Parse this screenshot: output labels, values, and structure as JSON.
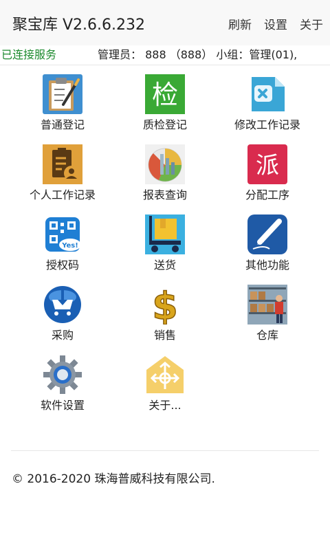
{
  "header": {
    "title": "聚宝库 V2.6.6.232",
    "menu": [
      "刷新",
      "设置",
      "关于"
    ]
  },
  "status": {
    "connection": "已连接服务",
    "admin_info": "管理员：  888  （888） 小组：管理(01),"
  },
  "tiles": [
    {
      "label": "普通登记",
      "icon": "clipboard-pen-icon"
    },
    {
      "label": "质检登记",
      "icon": "inspection-icon"
    },
    {
      "label": "修改工作记录",
      "icon": "edit-document-icon"
    },
    {
      "label": "个人工作记录",
      "icon": "personal-record-icon"
    },
    {
      "label": "报表查询",
      "icon": "report-chart-icon"
    },
    {
      "label": "分配工序",
      "icon": "dispatch-icon"
    },
    {
      "label": "授权码",
      "icon": "qr-code-icon"
    },
    {
      "label": "送货",
      "icon": "delivery-cart-icon"
    },
    {
      "label": "其他功能",
      "icon": "pen-icon"
    },
    {
      "label": "采购",
      "icon": "purchase-cart-icon"
    },
    {
      "label": "销售",
      "icon": "dollar-icon"
    },
    {
      "label": "仓库",
      "icon": "warehouse-icon"
    },
    {
      "label": "软件设置",
      "icon": "gear-icon"
    },
    {
      "label": "关于...",
      "icon": "about-icon"
    }
  ],
  "icon_text": {
    "inspection": "检",
    "dispatch": "派",
    "qr_yes": "Yes!",
    "dollar": "$"
  },
  "footer": {
    "copyright": "© 2016-2020 珠海普威科技有限公司."
  },
  "colors": {
    "status_connected": "#1c8a2e",
    "inspection_green": "#3aa935",
    "dispatch_red": "#d92b4e"
  }
}
